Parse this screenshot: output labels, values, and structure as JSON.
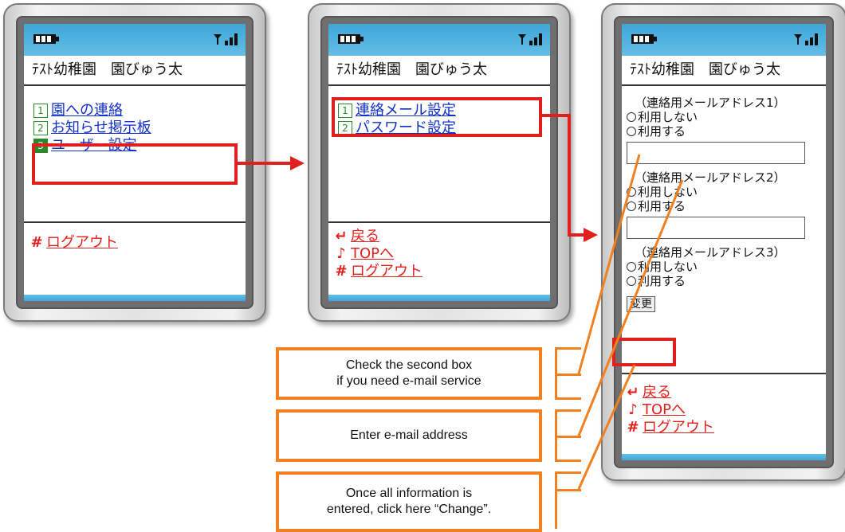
{
  "phone1": {
    "name_line": "ﾃｽﾄ幼稚園　園びゅう太",
    "menu": [
      {
        "num": "1",
        "label": "園への連絡"
      },
      {
        "num": "2",
        "label": "お知らせ掲示板"
      },
      {
        "num": "3",
        "label": "ユーザー設定"
      }
    ],
    "logout": {
      "glyph": "#",
      "label": "ログアウト"
    }
  },
  "phone2": {
    "name_line": "ﾃｽﾄ幼稚園　園びゅう太",
    "menu": [
      {
        "num": "1",
        "label": "連絡メール設定"
      },
      {
        "num": "2",
        "label": "パスワード設定"
      }
    ],
    "nav": [
      {
        "glyph": "↵",
        "label": "戻る"
      },
      {
        "glyph": "♪",
        "label": "TOPへ"
      },
      {
        "glyph": "#",
        "label": "ログアウト"
      }
    ]
  },
  "phone3": {
    "name_line": "ﾃｽﾄ幼稚園　園びゅう太",
    "sections": [
      {
        "header": "（連絡用メールアドレス1）",
        "opt_no": "利用しない",
        "opt_yes": "利用する",
        "show_field": true
      },
      {
        "header": "（連絡用メールアドレス2）",
        "opt_no": "利用しない",
        "opt_yes": "利用する",
        "show_field": true
      },
      {
        "header": "（連絡用メールアドレス3）",
        "opt_no": "利用しない",
        "opt_yes": "利用する",
        "show_field": false
      }
    ],
    "change_button": "変更",
    "nav": [
      {
        "glyph": "↵",
        "label": "戻る"
      },
      {
        "glyph": "♪",
        "label": "TOPへ"
      },
      {
        "glyph": "#",
        "label": "ログアウト"
      }
    ]
  },
  "notes": {
    "checkbox_line1": "Check the second box",
    "checkbox_line2": "if you need e-mail service",
    "email": "Enter e-mail address",
    "change_line1": "Once all information is",
    "change_line2": "entered, click here “Change”."
  },
  "colors": {
    "highlight": "#e0201c",
    "callout": "#f08020",
    "link": "#1030c8"
  }
}
